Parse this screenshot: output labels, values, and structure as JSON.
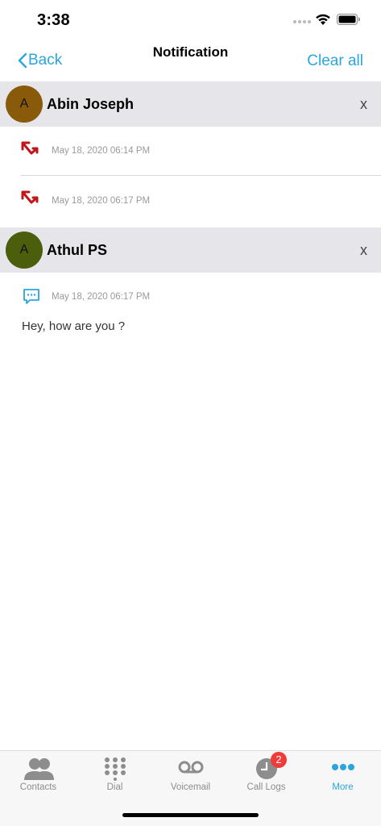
{
  "status_bar": {
    "time": "3:38"
  },
  "nav": {
    "back_label": "Back",
    "title": "Notification",
    "clear_all_label": "Clear all"
  },
  "groups": [
    {
      "avatar_letter": "A",
      "avatar_color": "#8a5a0b",
      "name": "Abin Joseph",
      "dismiss_label": "x",
      "items": [
        {
          "type": "missed-call",
          "icon": "missed-call-arrow-icon",
          "time": "May 18, 2020 06:14 PM"
        },
        {
          "type": "missed-call",
          "icon": "missed-call-arrow-icon",
          "time": "May 18, 2020 06:17 PM"
        }
      ]
    },
    {
      "avatar_letter": "A",
      "avatar_color": "#4a5e0b",
      "name": "Athul PS",
      "dismiss_label": "x",
      "items": [
        {
          "type": "message",
          "icon": "chat-bubble-icon",
          "time": "May 18, 2020 06:17 PM",
          "text": "Hey, how are you ?"
        }
      ]
    }
  ],
  "tabs": [
    {
      "label": "Contacts",
      "icon": "contacts-icon"
    },
    {
      "label": "Dial",
      "icon": "dialpad-icon"
    },
    {
      "label": "Voicemail",
      "icon": "voicemail-icon"
    },
    {
      "label": "Call Logs",
      "icon": "clock-icon",
      "badge": "2"
    },
    {
      "label": "More",
      "icon": "more-dots-icon",
      "active": true
    }
  ],
  "colors": {
    "accent": "#2aa6dc",
    "missed_call": "#c0151b",
    "badge": "#f03b3b",
    "header_bg": "#e6e6ea"
  }
}
